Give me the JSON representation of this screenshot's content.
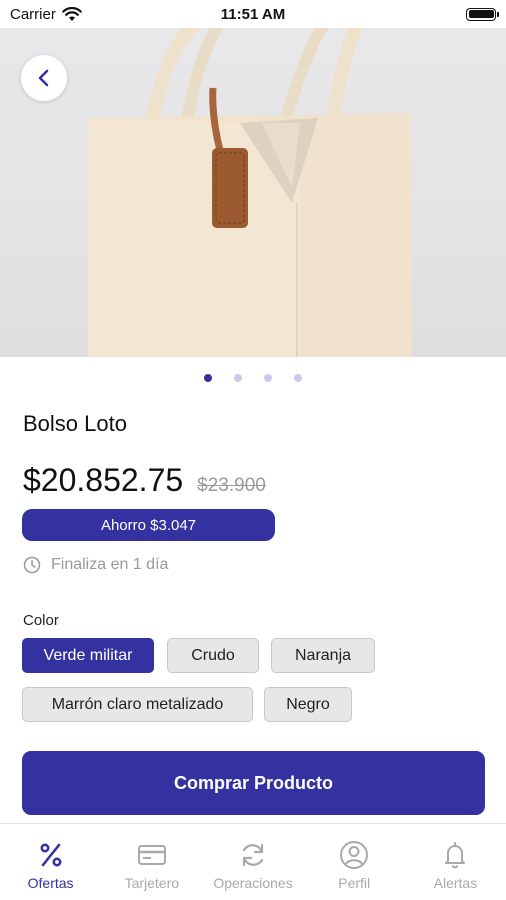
{
  "status_bar": {
    "carrier": "Carrier",
    "time": "11:51 AM"
  },
  "hero": {
    "image_alt": "cream leather tote bag with brown leather tag"
  },
  "carousel": {
    "total": 4,
    "active_index": 0
  },
  "product": {
    "name": "Bolso Loto",
    "price": "$20.852.75",
    "old_price": "$23.900",
    "savings": "Ahorro $3.047",
    "ends_text": "Finaliza en 1 día"
  },
  "color_section": {
    "label": "Color",
    "options": [
      "Verde militar",
      "Crudo",
      "Naranja",
      "Marrón claro metalizado",
      "Negro"
    ],
    "selected": "Verde militar"
  },
  "buy_button": {
    "label": "Comprar Producto"
  },
  "tabs": [
    {
      "label": "Ofertas",
      "icon": "percent-icon",
      "active": true
    },
    {
      "label": "Tarjetero",
      "icon": "card-icon",
      "active": false
    },
    {
      "label": "Operaciones",
      "icon": "refresh-icon",
      "active": false
    },
    {
      "label": "Perfil",
      "icon": "user-icon",
      "active": false
    },
    {
      "label": "Alertas",
      "icon": "bell-icon",
      "active": false
    }
  ],
  "colors": {
    "accent": "#3431a1",
    "inactive": "#a9a9a9",
    "chip_bg": "#e7e7e7"
  }
}
